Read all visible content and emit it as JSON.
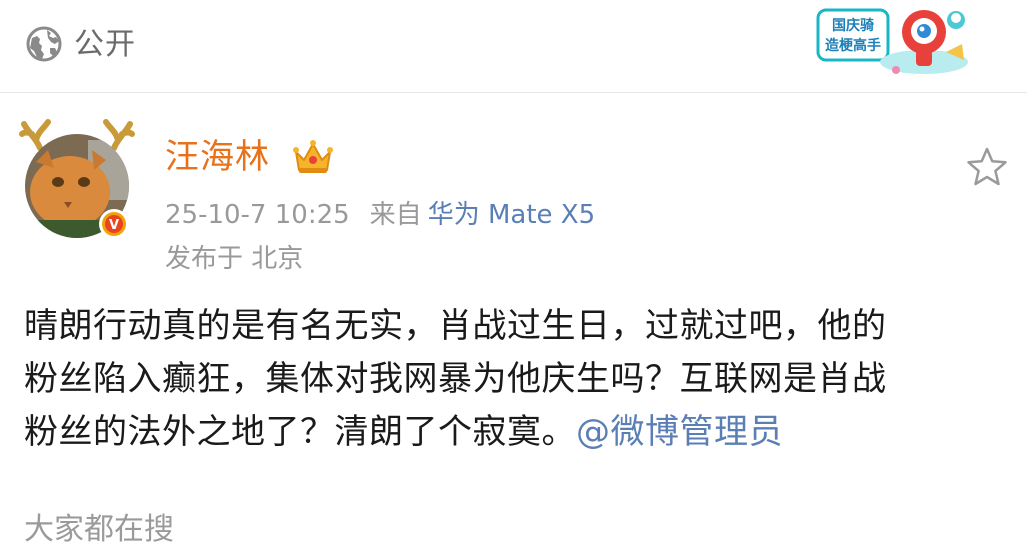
{
  "visibility": {
    "icon": "globe-icon",
    "label": "公开"
  },
  "badge": {
    "line1": "国庆骑",
    "line2": "造梗高手"
  },
  "post": {
    "author": {
      "name": "汪海林",
      "avatar": "cat-avatar-with-antlers",
      "verified_badge": "V",
      "crown_icon": "crown-icon"
    },
    "favorite_icon": "star-outline-icon",
    "timestamp": "25-10-7 10:25",
    "source_prefix": "来自",
    "device": "华为 Mate X5",
    "location": "发布于 北京",
    "content_lines": [
      "晴朗行动真的是有名无实，肖战过生日，过就过吧，他的",
      "粉丝陷入癫狂，集体对我网暴为他庆生吗？互联网是肖战",
      "粉丝的法外之地了？清朗了个寂寞。"
    ],
    "mention": "@微博管理员"
  },
  "footer": {
    "section_title": "大家都在搜"
  },
  "colors": {
    "username": "#e8711b",
    "link": "#5b7fb4",
    "muted": "#999999",
    "text": "#1a1a1a",
    "verified": "#f1a10a"
  }
}
